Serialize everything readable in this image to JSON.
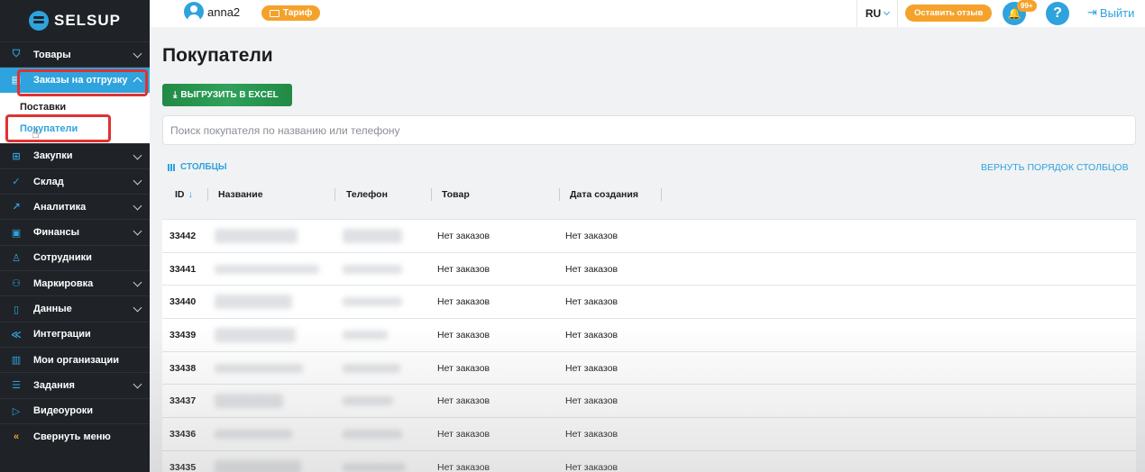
{
  "logo": {
    "text": "SELSUP"
  },
  "sidebar": {
    "items": [
      {
        "label": "Товары",
        "icon": "bag-icon",
        "has_chevron": true
      },
      {
        "label": "Заказы на отгрузку",
        "icon": "cart-icon",
        "has_chevron": true,
        "active": true
      },
      {
        "label": "Закупки",
        "icon": "basket-icon",
        "has_chevron": true
      },
      {
        "label": "Склад",
        "icon": "check-circle-icon",
        "has_chevron": true
      },
      {
        "label": "Аналитика",
        "icon": "chart-icon",
        "has_chevron": true
      },
      {
        "label": "Финансы",
        "icon": "wallet-icon",
        "has_chevron": true
      },
      {
        "label": "Сотрудники",
        "icon": "person-icon",
        "has_chevron": false
      },
      {
        "label": "Маркировка",
        "icon": "marking-icon",
        "has_chevron": true
      },
      {
        "label": "Данные",
        "icon": "document-icon",
        "has_chevron": true
      },
      {
        "label": "Интеграции",
        "icon": "integration-icon",
        "has_chevron": false
      },
      {
        "label": "Мои организации",
        "icon": "building-icon",
        "has_chevron": false
      },
      {
        "label": "Задания",
        "icon": "tasks-icon",
        "has_chevron": true
      },
      {
        "label": "Видеоуроки",
        "icon": "video-icon",
        "has_chevron": false
      },
      {
        "label": "Свернуть меню",
        "icon": "double-chevron-left-icon",
        "has_chevron": false
      }
    ],
    "sub_items": [
      {
        "label": "Поставки"
      },
      {
        "label": "Покупатели",
        "active": true
      }
    ]
  },
  "topbar": {
    "username": "anna2",
    "tariff_label": "Тариф",
    "language": "RU",
    "review_label": "Оставить отзыв",
    "notifications_badge": "99+",
    "help_label": "?",
    "logout_label": "Выйти"
  },
  "main": {
    "title": "Покупатели",
    "export_button": "ВЫГРУЗИТЬ В EXCEL",
    "search_placeholder": "Поиск покупателя по названию или телефону",
    "columns_button": "СТОЛБЦЫ",
    "reset_columns": "ВЕРНУТЬ ПОРЯДОК СТОЛБЦОВ",
    "table": {
      "headers": [
        "ID",
        "Название",
        "Телефон",
        "Товар",
        "Дата создания"
      ],
      "rows": [
        {
          "id": "33442",
          "goods": "Нет заказов",
          "date": "Нет заказов"
        },
        {
          "id": "33441",
          "goods": "Нет заказов",
          "date": "Нет заказов"
        },
        {
          "id": "33440",
          "goods": "Нет заказов",
          "date": "Нет заказов"
        },
        {
          "id": "33439",
          "goods": "Нет заказов",
          "date": "Нет заказов"
        },
        {
          "id": "33438",
          "goods": "Нет заказов",
          "date": "Нет заказов"
        },
        {
          "id": "33437",
          "goods": "Нет заказов",
          "date": "Нет заказов"
        },
        {
          "id": "33436",
          "goods": "Нет заказов",
          "date": "Нет заказов"
        },
        {
          "id": "33435",
          "goods": "Нет заказов",
          "date": "Нет заказов"
        }
      ]
    }
  },
  "colors": {
    "accent": "#2ea3dd",
    "sidebar_bg": "#1f2328",
    "orange": "#f4a22b",
    "excel_green": "#2fa15a",
    "highlight_red": "#e03131"
  }
}
